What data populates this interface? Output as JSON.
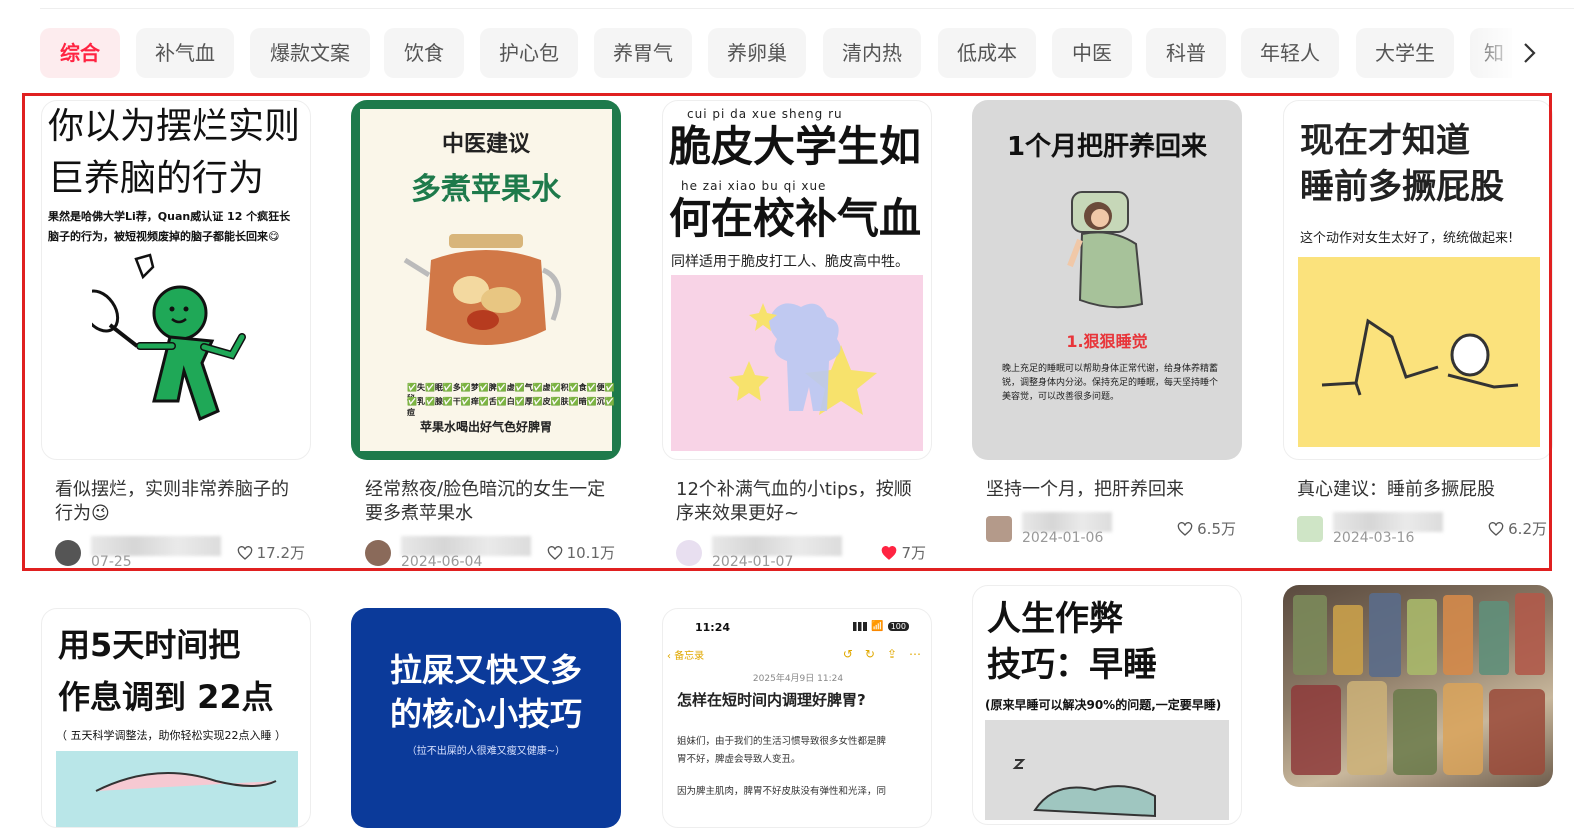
{
  "tabs": [
    {
      "label": "综合",
      "active": true
    },
    {
      "label": "补气血"
    },
    {
      "label": "爆款文案"
    },
    {
      "label": "饮食"
    },
    {
      "label": "护心包"
    },
    {
      "label": "养胃气"
    },
    {
      "label": "养卵巢"
    },
    {
      "label": "清内热"
    },
    {
      "label": "低成本"
    },
    {
      "label": "中医"
    },
    {
      "label": "科普"
    },
    {
      "label": "年轻人"
    },
    {
      "label": "大学生"
    },
    {
      "label": "知"
    }
  ],
  "tab_arrow_icon": "chevron-right-icon",
  "cards": [
    {
      "cover": {
        "line1": "你以为摆烂实则",
        "line2": "巨养脑的行为",
        "sub1": "果然是哈佛大学Li荐，Quan威认证 12 个疯狂长",
        "sub2": "脑子的行为，被短视频废掉的脑子都能长回来😋"
      },
      "title": "看似摆烂，实则非常养脑子的行为😉",
      "date": "07-25",
      "likes": "17.2万",
      "liked": false
    },
    {
      "cover": {
        "line1": "中医建议",
        "line2": "多煮苹果水",
        "check1": "✅失✅眠✅多✅梦✅脾✅虚✅气✅虚✅积✅食✅便✅秘",
        "check2": "✅乳✅腺✅干✅痒✅舌✅白✅厚✅皮✅肤✅暗✅沉✅痘",
        "bottom": "苹果水喝出好气色好脾胃"
      },
      "title": "经常熬夜/脸色暗沉的女生一定要多煮苹果水",
      "date": "2024-06-04",
      "likes": "10.1万",
      "liked": false
    },
    {
      "cover": {
        "pinyin1": "cui  pi   da  xue sheng ru",
        "line1": "脆皮大学生如",
        "pinyin2": "he  zai  xiao  bu   qi   xue",
        "line2": "何在校补气血",
        "sub": "同样适用于脆皮打工人、脆皮高中牲。"
      },
      "title": "12个补满气血的小tips，按顺序来效果更好~",
      "date": "2024-01-07",
      "likes": "7万",
      "liked": true
    },
    {
      "cover": {
        "line1": "1个月把肝养回来",
        "step": "1.狠狠睡觉",
        "body": "晚上充足的睡眠可以帮助身体正常代谢，给身体养精蓄锐，调整身体内分泌。保持充足的睡眠，每天坚持睡个美容觉，可以改善很多问题。"
      },
      "title": "坚持一个月，把肝养回来",
      "date": "2024-01-06",
      "likes": "6.5万",
      "liked": false
    },
    {
      "cover": {
        "line1": "现在才知道",
        "line2": "睡前多撅屁股",
        "sub": "这个动作对女生太好了，统统做起来!"
      },
      "title": "真心建议：睡前多撅屁股",
      "date": "2024-03-16",
      "likes": "6.2万",
      "liked": false
    }
  ],
  "row2": [
    {
      "line1": "用5天时间把",
      "line2": "作息调到 22点",
      "sub": "（ 五天科学调整法，助你轻松实现22点入睡 ）"
    },
    {
      "line1": "拉屎又快又多",
      "line2": "的核心小技巧",
      "sub": "（拉不出屎的人很难又瘦又健康~）"
    },
    {
      "time": "11:24",
      "battery": "100",
      "back": "备忘录",
      "date": "2025年4月9日 11:24",
      "heading": "怎样在短时间内调理好脾胃?",
      "p1a": "姐妹们，由于我们的生活习惯导致很多女性都是脾",
      "p1b": "胃不好，脾虚会导致人变丑。",
      "p2": "因为脾主肌肉，脾胃不好皮肤没有弹性和光泽，同"
    },
    {
      "line1": "人生作弊",
      "line2": "技巧：早睡",
      "sub": "(原来早睡可以解决90%的问题,一定要早睡)"
    },
    {
      "photo": "jars-photo"
    }
  ],
  "colors": {
    "accent": "#ff2442",
    "highlight": "#e02020",
    "green_border": "#1e7a4b"
  }
}
